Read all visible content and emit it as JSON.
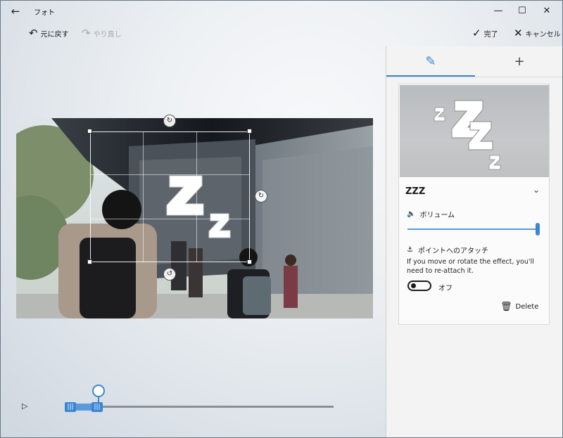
{
  "window": {
    "title": "フォト"
  },
  "toolbar": {
    "undo_label": "元に戻す",
    "redo_label": "やり直し",
    "done_label": "完了",
    "cancel_label": "キャンセル"
  },
  "effect_panel": {
    "effect_name": "ZZZ",
    "volume_label": "ボリューム",
    "volume_level": 1.0,
    "anchor_label": "ポイントへのアタッチ",
    "anchor_description": "If you move or rotate the effect, you'll need to re-attach it.",
    "toggle_state_label": "オフ",
    "delete_label": "Delete"
  },
  "timeline": {
    "trim_start_fraction": 0.0,
    "trim_end_fraction": 0.13,
    "playhead_fraction": 0.12
  },
  "colors": {
    "accent": "#3b86d4",
    "panel_bg": "#f3f3f3"
  },
  "icons": {
    "back": "back-arrow-icon",
    "undo": "undo-icon",
    "redo": "redo-icon",
    "done": "check-icon",
    "cancel": "close-icon",
    "tab_edit": "pencil-icon",
    "tab_add": "plus-icon",
    "volume": "speaker-icon",
    "anchor": "anchor-icon",
    "delete": "trash-icon",
    "play": "play-icon"
  }
}
